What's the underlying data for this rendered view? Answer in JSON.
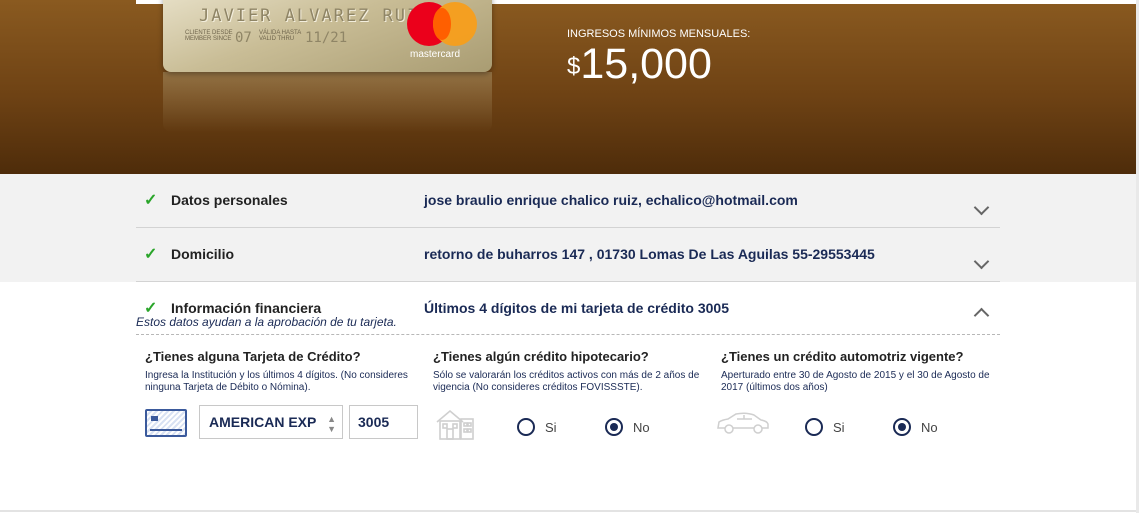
{
  "hero": {
    "card_name": "JAVIER ALVAREZ RUIZ",
    "card_small_1": "CLIENTE DESDE MEMBER SINCE",
    "card_num_1": "07",
    "card_small_2": "VÁLIDA HASTA VALID THRU",
    "card_num_2": "11/21",
    "brand": "mastercard",
    "income_label": "INGRESOS MÍNIMOS MENSUALES:",
    "income_currency": "$",
    "income_amount": "15,000"
  },
  "sections": {
    "personal": {
      "title": "Datos personales",
      "value": "jose braulio enrique chalico ruiz, echalico@hotmail.com"
    },
    "address": {
      "title": "Domicilio",
      "value": "retorno de buharros 147 , 01730 Lomas De Las Aguilas 55-29553445"
    },
    "financial": {
      "title": "Información financiera",
      "value": "Últimos 4 dígitos de mi tarjeta de crédito 3005",
      "help": "Estos datos ayudan a la aprobación de tu tarjeta."
    }
  },
  "questions": {
    "credit_card": {
      "title": "¿Tienes alguna Tarjeta de Crédito?",
      "desc": "Ingresa la Institución y los últimos 4 dígitos. (No consideres ninguna Tarjeta de Débito o Nómina).",
      "institution": "AMERICAN EXP",
      "last_digits": "3005"
    },
    "mortgage": {
      "title": "¿Tienes algún crédito hipotecario?",
      "desc": "Sólo se valorarán los créditos activos con más de 2 años de vigencia (No consideres créditos FOVISSSTE).",
      "yes_label": "Si",
      "no_label": "No",
      "selected": "No"
    },
    "auto": {
      "title": "¿Tienes un crédito automotriz vigente?",
      "desc": "Aperturado entre 30 de Agosto de 2015 y el 30 de Agosto de 2017 (últimos dos años)",
      "yes_label": "Si",
      "no_label": "No",
      "selected": "No"
    }
  },
  "colors": {
    "hero_brown": "#6e4214",
    "navy": "#1a2a55",
    "check_green": "#2aa52a"
  }
}
